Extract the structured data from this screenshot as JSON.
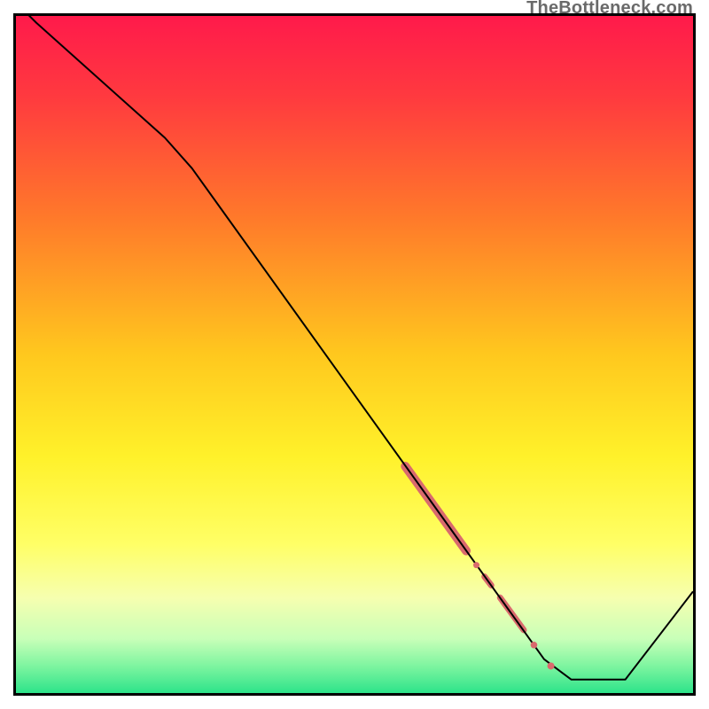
{
  "watermark": "TheBottleneck.com",
  "chart_data": {
    "type": "line",
    "title": "",
    "xlabel": "",
    "ylabel": "",
    "xlim": [
      0,
      100
    ],
    "ylim": [
      0,
      100
    ],
    "background_gradient": {
      "stops": [
        {
          "offset": 0.0,
          "color": "#ff1a4b"
        },
        {
          "offset": 0.12,
          "color": "#ff3a3f"
        },
        {
          "offset": 0.3,
          "color": "#ff7a2a"
        },
        {
          "offset": 0.5,
          "color": "#ffc81e"
        },
        {
          "offset": 0.65,
          "color": "#fff12a"
        },
        {
          "offset": 0.78,
          "color": "#ffff66"
        },
        {
          "offset": 0.86,
          "color": "#f6ffb0"
        },
        {
          "offset": 0.92,
          "color": "#c8ffb8"
        },
        {
          "offset": 0.96,
          "color": "#7ef5a0"
        },
        {
          "offset": 1.0,
          "color": "#2de38a"
        }
      ]
    },
    "series": [
      {
        "name": "bottleneck-curve",
        "stroke": "#000000",
        "stroke_width": 2,
        "points": [
          {
            "x": 0.0,
            "y": 102.0
          },
          {
            "x": 3.0,
            "y": 99.0
          },
          {
            "x": 22.0,
            "y": 82.0
          },
          {
            "x": 26.0,
            "y": 77.5
          },
          {
            "x": 78.0,
            "y": 5.0
          },
          {
            "x": 82.0,
            "y": 2.0
          },
          {
            "x": 90.0,
            "y": 2.0
          },
          {
            "x": 100.0,
            "y": 15.0
          }
        ]
      }
    ],
    "highlight_segments": [
      {
        "name": "thick-segment",
        "color": "#d96a6d",
        "width": 10,
        "cap": "round",
        "points": [
          {
            "x": 57.5,
            "y": 33.5
          },
          {
            "x": 66.5,
            "y": 21.0
          }
        ]
      },
      {
        "name": "mid-dash",
        "color": "#d96a6d",
        "width": 7,
        "cap": "round",
        "points": [
          {
            "x": 69.2,
            "y": 17.2
          },
          {
            "x": 70.2,
            "y": 15.9
          }
        ]
      },
      {
        "name": "lower-dash",
        "color": "#d96a6d",
        "width": 7,
        "cap": "round",
        "points": [
          {
            "x": 71.5,
            "y": 14.1
          },
          {
            "x": 75.0,
            "y": 9.3
          }
        ]
      }
    ],
    "highlight_dots": [
      {
        "x": 68.0,
        "y": 18.9,
        "r": 3.5,
        "color": "#d96a6d"
      },
      {
        "x": 76.5,
        "y": 7.1,
        "r": 3.8,
        "color": "#d96a6d"
      },
      {
        "x": 79.0,
        "y": 4.0,
        "r": 4.0,
        "color": "#d96a6d"
      }
    ]
  }
}
